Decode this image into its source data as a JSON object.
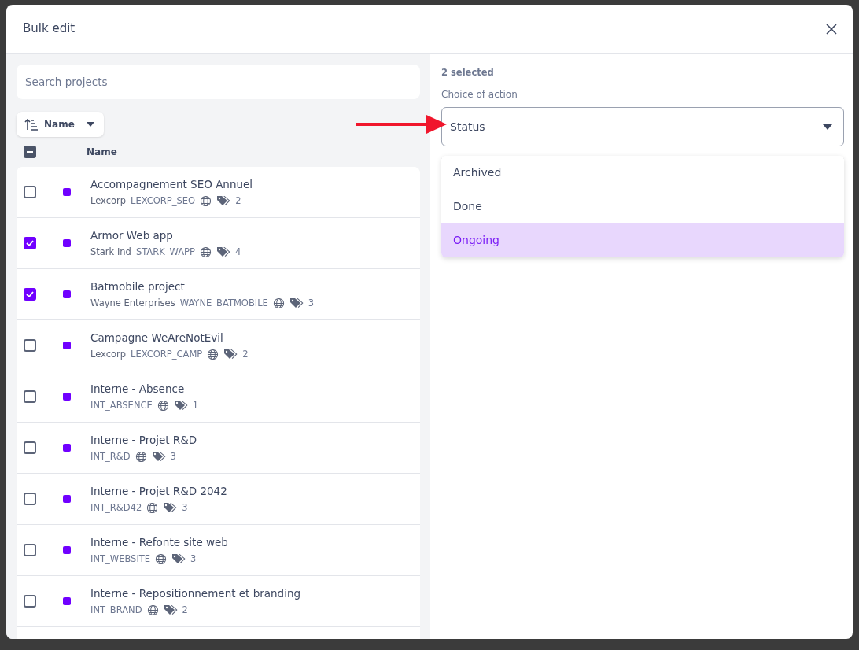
{
  "dialog": {
    "title": "Bulk edit"
  },
  "search": {
    "placeholder": "Search projects"
  },
  "sort": {
    "label": "Name"
  },
  "list_header": {
    "select_all_indeterminate": true,
    "column": "Name"
  },
  "projects": [
    {
      "name": "Accompagnement SEO Annuel",
      "client": "Lexcorp",
      "code": "LEXCORP_SEO",
      "tags": "2",
      "checked": false,
      "color": "#7000ff"
    },
    {
      "name": "Armor Web app",
      "client": "Stark Ind",
      "code": "STARK_WAPP",
      "tags": "4",
      "checked": true,
      "color": "#7000ff"
    },
    {
      "name": "Batmobile project",
      "client": "Wayne Enterprises",
      "code": "WAYNE_BATMOBILE",
      "tags": "3",
      "checked": true,
      "color": "#7000ff"
    },
    {
      "name": "Campagne WeAreNotEvil",
      "client": "Lexcorp",
      "code": "LEXCORP_CAMP",
      "tags": "2",
      "checked": false,
      "color": "#7000ff"
    },
    {
      "name": "Interne - Absence",
      "code": "INT_ABSENCE",
      "tags": "1",
      "checked": false,
      "color": "#7000ff"
    },
    {
      "name": "Interne - Projet R&D",
      "code": "INT_R&D",
      "tags": "3",
      "checked": false,
      "color": "#7000ff"
    },
    {
      "name": "Interne - Projet R&D 2042",
      "code": "INT_R&D42",
      "tags": "3",
      "checked": false,
      "color": "#7000ff"
    },
    {
      "name": "Interne - Refonte site web",
      "code": "INT_WEBSITE",
      "tags": "3",
      "checked": false,
      "color": "#7000ff"
    },
    {
      "name": "Interne - Repositionnement et branding",
      "code": "INT_BRAND",
      "tags": "2",
      "checked": false,
      "color": "#7000ff"
    }
  ],
  "selection": {
    "count": "2 selected",
    "action_label": "Choice of action",
    "action_value": "Status"
  },
  "status_options": [
    {
      "label": "Archived",
      "selected": false
    },
    {
      "label": "Done",
      "selected": false
    },
    {
      "label": "Ongoing",
      "selected": true
    }
  ]
}
